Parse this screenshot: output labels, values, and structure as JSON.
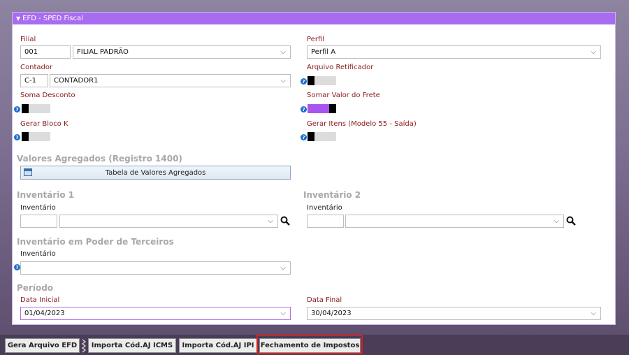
{
  "panel": {
    "title": "EFD - SPED Fiscal"
  },
  "filial": {
    "label": "Filial",
    "code": "001",
    "name": "FILIAL PADRÃO"
  },
  "perfil": {
    "label": "Perfil",
    "value": "Perfil A"
  },
  "contador": {
    "label": "Contador",
    "code": "C-1",
    "name": "CONTADOR1"
  },
  "arquivo_retificador": {
    "label": "Arquivo Retificador",
    "on": false
  },
  "soma_desconto": {
    "label": "Soma Desconto",
    "on": false
  },
  "somar_frete": {
    "label": "Somar Valor do Frete",
    "on": true
  },
  "gerar_bloco_k": {
    "label": "Gerar Bloco K",
    "on": false
  },
  "gerar_itens": {
    "label": "Gerar Itens (Modelo 55 - Saída)",
    "on": false
  },
  "valores": {
    "title": "Valores Agregados (Registro 1400)",
    "button": "Tabela de Valores Agregados"
  },
  "inventario1": {
    "title": "Inventário 1",
    "label": "Inventário",
    "code": "",
    "value": ""
  },
  "inventario2": {
    "title": "Inventário 2",
    "label": "Inventário",
    "code": "",
    "value": ""
  },
  "terceiros": {
    "title": "Inventário em Poder de Terceiros",
    "label": "Inventário",
    "value": ""
  },
  "periodo": {
    "title": "Período",
    "inicial_label": "Data Inicial",
    "inicial": "01/04/2023",
    "final_label": "Data Final",
    "final": "30/04/2023"
  },
  "toolbar": {
    "gera": "Gera Arquivo EFD",
    "icms": "Importa Cód.AJ ICMS",
    "ipi": "Importa Cód.AJ IPI",
    "fechamento": "Fechamento de Impostos"
  },
  "colors": {
    "accent": "#a86cf0",
    "toggle_on": "#a855f0",
    "label": "#8a1a1a",
    "highlight": "#d61f1f"
  }
}
